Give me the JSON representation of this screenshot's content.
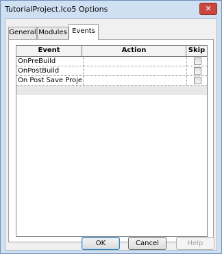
{
  "window": {
    "title": "TutorialProject.lco5 Options",
    "close_label": "✕"
  },
  "tabs": [
    {
      "label": "General",
      "active": false
    },
    {
      "label": "Modules",
      "active": false
    },
    {
      "label": "Events",
      "active": true
    }
  ],
  "grid": {
    "columns": [
      "Event",
      "Action",
      "Skip"
    ],
    "rows": [
      {
        "event": "OnPreBuild",
        "action": "",
        "skip": false
      },
      {
        "event": "OnPostBuild",
        "action": "",
        "skip": false
      },
      {
        "event": "On Post Save Project",
        "action": "",
        "skip": false
      }
    ]
  },
  "buttons": {
    "ok": "OK",
    "cancel": "Cancel",
    "help": "Help"
  }
}
